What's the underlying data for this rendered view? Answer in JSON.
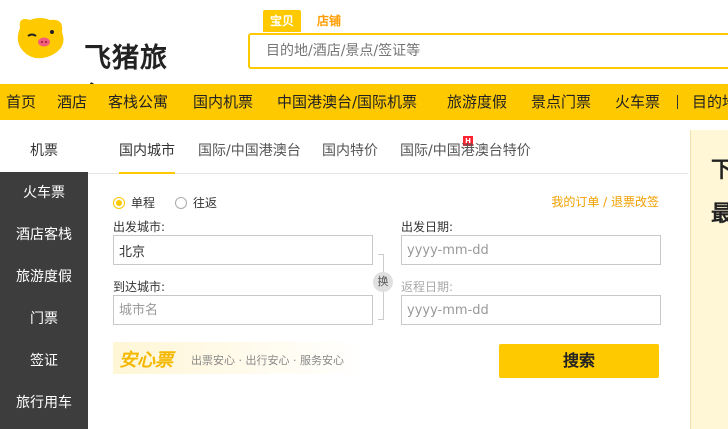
{
  "brand": {
    "name": "飞猪旅行",
    "logo_icon": "fliggy-pig-icon",
    "accent": "#ffc900",
    "accent_text": "#ff9d00"
  },
  "search": {
    "tabs": [
      {
        "label": "宝贝",
        "active": true
      },
      {
        "label": "店铺",
        "active": false
      }
    ],
    "placeholder": "目的地/酒店/景点/签证等"
  },
  "nav": {
    "items": [
      "首页",
      "酒店",
      "客栈公寓",
      "国内机票",
      "中国港澳台/国际机票",
      "旅游度假",
      "景点门票",
      "火车票",
      "目的地"
    ]
  },
  "sidebar": {
    "items": [
      "机票",
      "火车票",
      "酒店客栈",
      "旅游度假",
      "门票",
      "签证",
      "旅行用车"
    ]
  },
  "tabs": [
    {
      "label": "国内城市",
      "active": true
    },
    {
      "label": "国际/中国港澳台",
      "active": false
    },
    {
      "label": "国内特价",
      "active": false,
      "badge": "H"
    },
    {
      "label": "国际/中国港澳台特价",
      "active": false
    }
  ],
  "form": {
    "trip_types": [
      {
        "label": "单程",
        "selected": true
      },
      {
        "label": "往返",
        "selected": false
      }
    ],
    "order_links": "我的订单 / 退票改签",
    "from_label": "出发城市:",
    "from_value": "北京",
    "to_label": "到达城市:",
    "to_placeholder": "城市名",
    "depart_label": "出发日期:",
    "depart_placeholder": "yyyy-mm-dd",
    "return_label": "返程日期:",
    "return_placeholder": "yyyy-mm-dd",
    "swap_label": "换",
    "promo_title": "安心票",
    "promo_sub": "出票安心 · 出行安心 · 服务安心",
    "search_button": "搜索"
  },
  "right_panel": {
    "line1": "下",
    "line2": "最"
  }
}
